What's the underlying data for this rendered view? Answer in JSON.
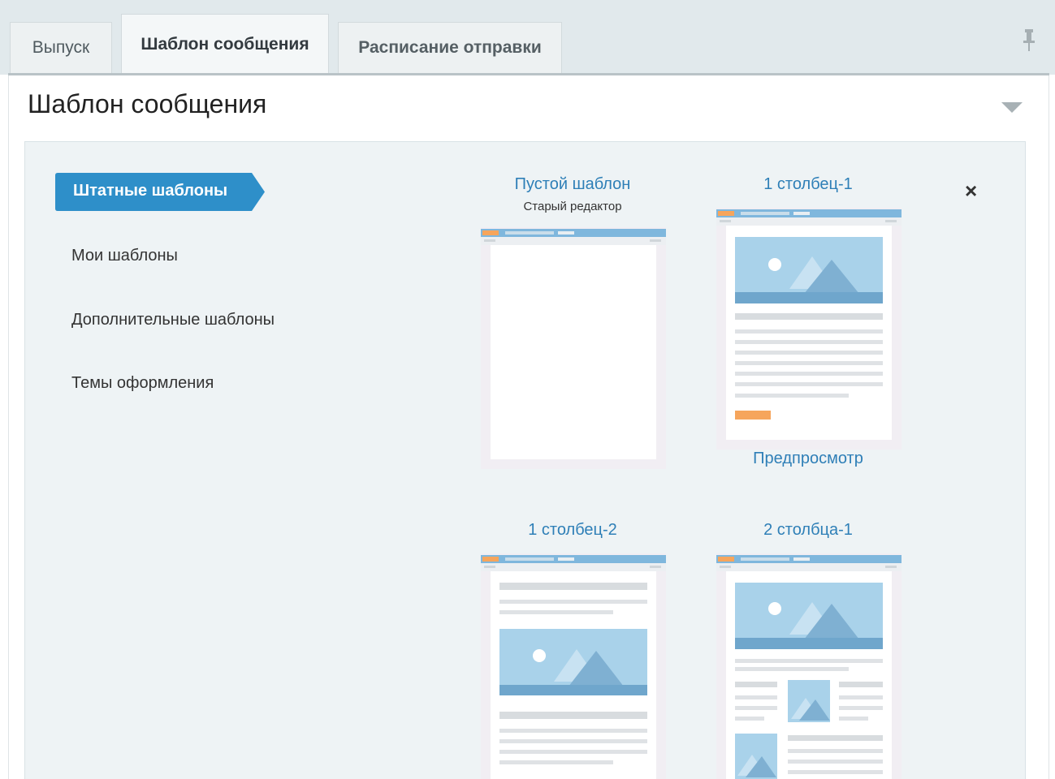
{
  "tabs": [
    {
      "label": "Выпуск"
    },
    {
      "label": "Шаблон сообщения"
    },
    {
      "label": "Расписание отправки"
    }
  ],
  "heading": "Шаблон сообщения",
  "sidebar": {
    "items": [
      {
        "label": "Штатные шаблоны"
      },
      {
        "label": "Мои шаблоны"
      },
      {
        "label": "Дополнительные шаблоны"
      },
      {
        "label": "Темы оформления"
      }
    ]
  },
  "templates": [
    {
      "title": "Пустой шаблон",
      "subtitle": "Старый редактор"
    },
    {
      "title": "1 столбец-1",
      "preview_label": "Предпросмотр"
    },
    {
      "title": "1 столбец-2"
    },
    {
      "title": "2 столбца-1"
    }
  ],
  "icons": {
    "pin": "pin-icon",
    "collapse": "chevron-down-icon",
    "close": "close-icon",
    "close_glyph": "×"
  },
  "colors": {
    "accent": "#2e8fc9",
    "link": "#2e7fb7",
    "thumb_header": "#7fb7dd",
    "thumb_orange": "#f6a55c",
    "image_fill": "#a9d2ea"
  }
}
